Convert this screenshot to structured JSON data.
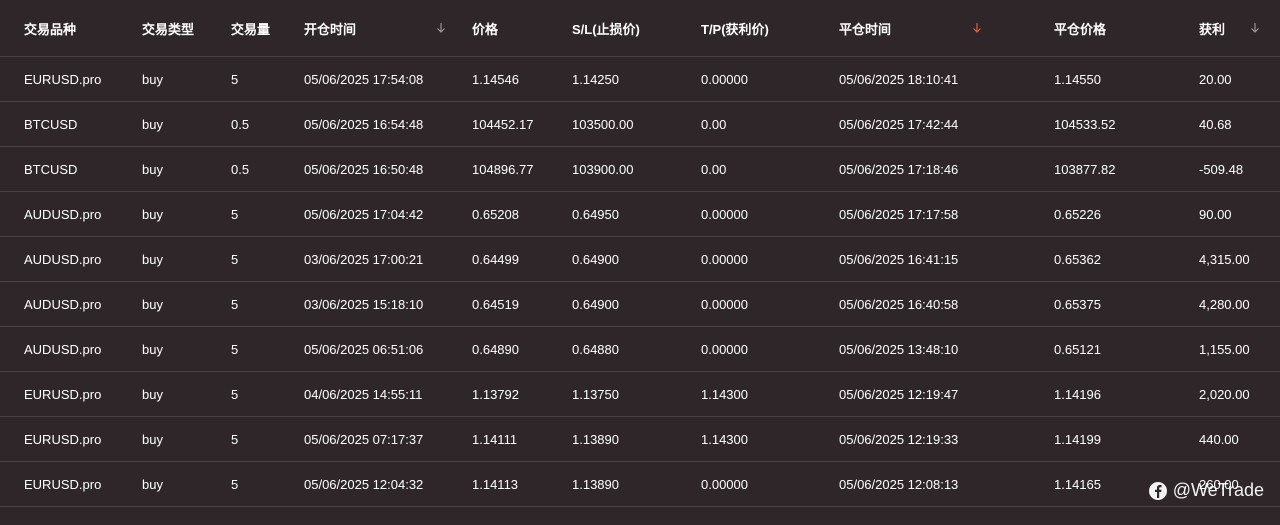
{
  "table": {
    "headers": [
      "交易品种",
      "交易类型",
      "交易量",
      "开仓时间",
      "价格",
      "S/L(止损价)",
      "T/P(获利价)",
      "平仓时间",
      "平仓价格",
      "获利"
    ],
    "sort_colors": {
      "default": "#9a9294",
      "active": "#e0603a"
    },
    "rows": [
      [
        "EURUSD.pro",
        "buy",
        "5",
        "05/06/2025 17:54:08",
        "1.14546",
        "1.14250",
        "0.00000",
        "05/06/2025 18:10:41",
        "1.14550",
        "20.00"
      ],
      [
        "BTCUSD",
        "buy",
        "0.5",
        "05/06/2025 16:54:48",
        "104452.17",
        "103500.00",
        "0.00",
        "05/06/2025 17:42:44",
        "104533.52",
        "40.68"
      ],
      [
        "BTCUSD",
        "buy",
        "0.5",
        "05/06/2025 16:50:48",
        "104896.77",
        "103900.00",
        "0.00",
        "05/06/2025 17:18:46",
        "103877.82",
        "-509.48"
      ],
      [
        "AUDUSD.pro",
        "buy",
        "5",
        "05/06/2025 17:04:42",
        "0.65208",
        "0.64950",
        "0.00000",
        "05/06/2025 17:17:58",
        "0.65226",
        "90.00"
      ],
      [
        "AUDUSD.pro",
        "buy",
        "5",
        "03/06/2025 17:00:21",
        "0.64499",
        "0.64900",
        "0.00000",
        "05/06/2025 16:41:15",
        "0.65362",
        "4,315.00"
      ],
      [
        "AUDUSD.pro",
        "buy",
        "5",
        "03/06/2025 15:18:10",
        "0.64519",
        "0.64900",
        "0.00000",
        "05/06/2025 16:40:58",
        "0.65375",
        "4,280.00"
      ],
      [
        "AUDUSD.pro",
        "buy",
        "5",
        "05/06/2025 06:51:06",
        "0.64890",
        "0.64880",
        "0.00000",
        "05/06/2025 13:48:10",
        "0.65121",
        "1,155.00"
      ],
      [
        "EURUSD.pro",
        "buy",
        "5",
        "04/06/2025 14:55:11",
        "1.13792",
        "1.13750",
        "1.14300",
        "05/06/2025 12:19:47",
        "1.14196",
        "2,020.00"
      ],
      [
        "EURUSD.pro",
        "buy",
        "5",
        "05/06/2025 07:17:37",
        "1.14111",
        "1.13890",
        "1.14300",
        "05/06/2025 12:19:33",
        "1.14199",
        "440.00"
      ],
      [
        "EURUSD.pro",
        "buy",
        "5",
        "05/06/2025 12:04:32",
        "1.14113",
        "1.13890",
        "0.00000",
        "05/06/2025 12:08:13",
        "1.14165",
        "260.00"
      ]
    ]
  },
  "watermark": {
    "text": "@WeTrade",
    "icon": "facebook-icon"
  }
}
